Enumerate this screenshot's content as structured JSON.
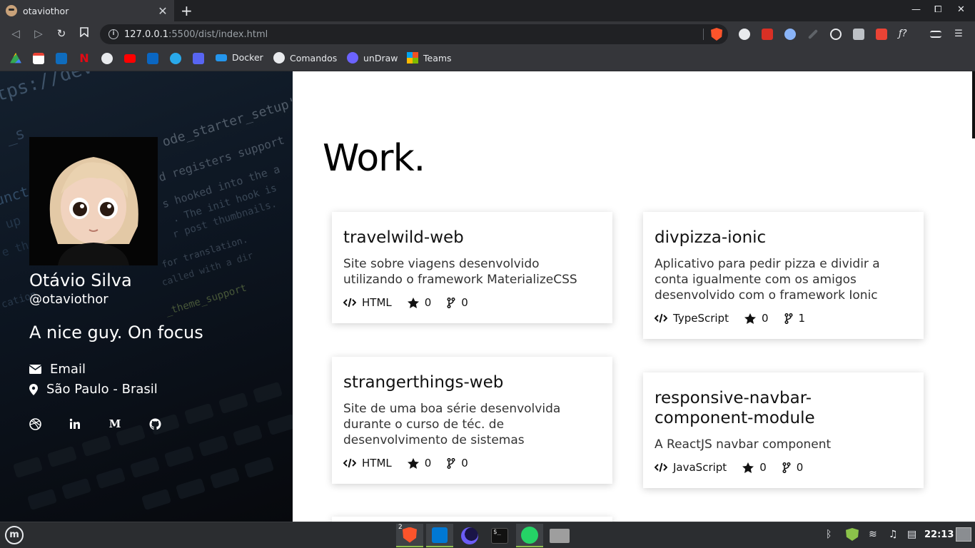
{
  "browser": {
    "tab_title": "otaviothor",
    "tab_close": "✕",
    "new_tab": "+",
    "window_controls": {
      "minimize": "—",
      "maximize": "⧠",
      "close": "✕"
    },
    "url_host": "127.0.0.1",
    "url_rest": ":5500/dist/index.html",
    "bookmarks": [
      {
        "label": "Docker"
      },
      {
        "label": "Comandos"
      },
      {
        "label": "unDraw"
      },
      {
        "label": "Teams"
      }
    ]
  },
  "profile": {
    "name": "Otávio Silva",
    "handle": "@otaviothor",
    "bio": "A nice guy. On focus",
    "email_label": "Email",
    "location": "São Paulo - Brasil",
    "socials": [
      "dribbble-icon",
      "linkedin-icon",
      "medium-icon",
      "github-icon"
    ]
  },
  "main": {
    "title": "Work."
  },
  "projects": [
    {
      "name": "travelwild-web",
      "description": "Site sobre viagens desenvolvido utilizando o framework MaterializeCSS",
      "language": "HTML",
      "stars": "0",
      "forks": "0"
    },
    {
      "name": "divpizza-ionic",
      "description": "Aplicativo para pedir pizza e dividir a conta igualmente com os amigos desenvolvido com o framework Ionic",
      "language": "TypeScript",
      "stars": "0",
      "forks": "1"
    },
    {
      "name": "strangerthings-web",
      "description": "Site de uma boa série desenvolvida durante o curso de téc. de desenvolvimento de sistemas",
      "language": "HTML",
      "stars": "0",
      "forks": "0"
    },
    {
      "name": "responsive-navbar-component-module",
      "description": "A ReactJS navbar component",
      "language": "JavaScript",
      "stars": "0",
      "forks": "0"
    }
  ],
  "taskbar": {
    "mint_label": "m",
    "badge": "2",
    "clock": "22:13"
  }
}
